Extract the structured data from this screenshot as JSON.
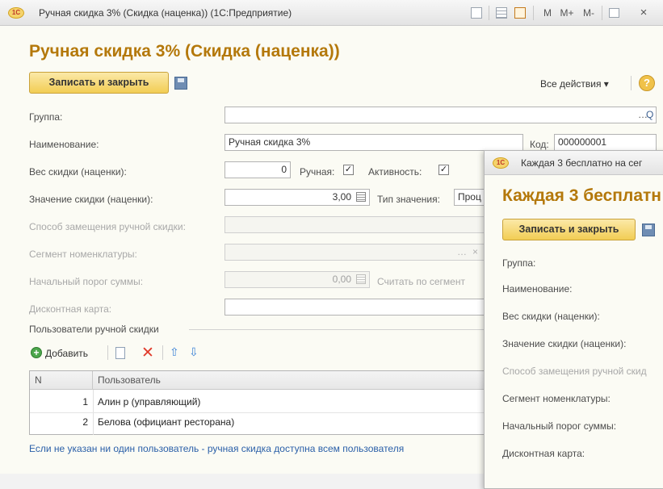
{
  "main_window": {
    "title": "Ручная скидка 3% (Скидка (наценка))  (1С:Предприятие)",
    "form_title": "Ручная скидка 3% (Скидка (наценка))",
    "titlebar_buttons": {
      "m": "M",
      "m_plus": "M+",
      "m_minus": "M-",
      "close": "×"
    },
    "toolbar": {
      "save_close": "Записать и закрыть",
      "all_actions": "Все действия ▾",
      "help": "?"
    },
    "fields": {
      "group_label": "Группа:",
      "group_value": "",
      "name_label": "Наименование:",
      "name_value": "Ручная скидка 3%",
      "code_label": "Код:",
      "code_value": "000000001",
      "weight_label": "Вес скидки (наценки):",
      "weight_value": "0",
      "manual_label": "Ручная:",
      "manual_checked": "✓",
      "active_label": "Активность:",
      "active_checked": "✓",
      "value_label": "Значение скидки (наценки):",
      "value_value": "3,00",
      "value_type_label": "Тип значения:",
      "value_type_value": "Проц",
      "replace_label": "Способ замещения ручной скидки:",
      "segment_label": "Сегмент номенклатуры:",
      "threshold_label": "Начальный порог суммы:",
      "threshold_value": "0,00",
      "by_segment_label": "Считать по сегмент",
      "card_label": "Дисконтная карта:"
    },
    "users_group": {
      "title": "Пользователи ручной скидки",
      "add_label": "Добавить",
      "columns": {
        "n": "N",
        "user": "Пользователь"
      },
      "rows": [
        {
          "n": "1",
          "user": "Алин р (управляющий)"
        },
        {
          "n": "2",
          "user": "Белова (официант ресторана)"
        }
      ],
      "hint": "Если не указан ни один пользователь - ручная скидка доступна всем пользователя"
    }
  },
  "second_window": {
    "title": "Каждая 3 бесплатно на сег",
    "form_title": "Каждая 3 бесплатн",
    "save_close": "Записать и закрыть",
    "labels": {
      "group": "Группа:",
      "name": "Наименование:",
      "weight": "Вес скидки (наценки):",
      "value": "Значение скидки (наценки):",
      "replace": "Способ замещения ручной скид",
      "segment": "Сегмент номенклатуры:",
      "threshold": "Начальный порог суммы:",
      "card": "Дисконтная карта:"
    }
  }
}
